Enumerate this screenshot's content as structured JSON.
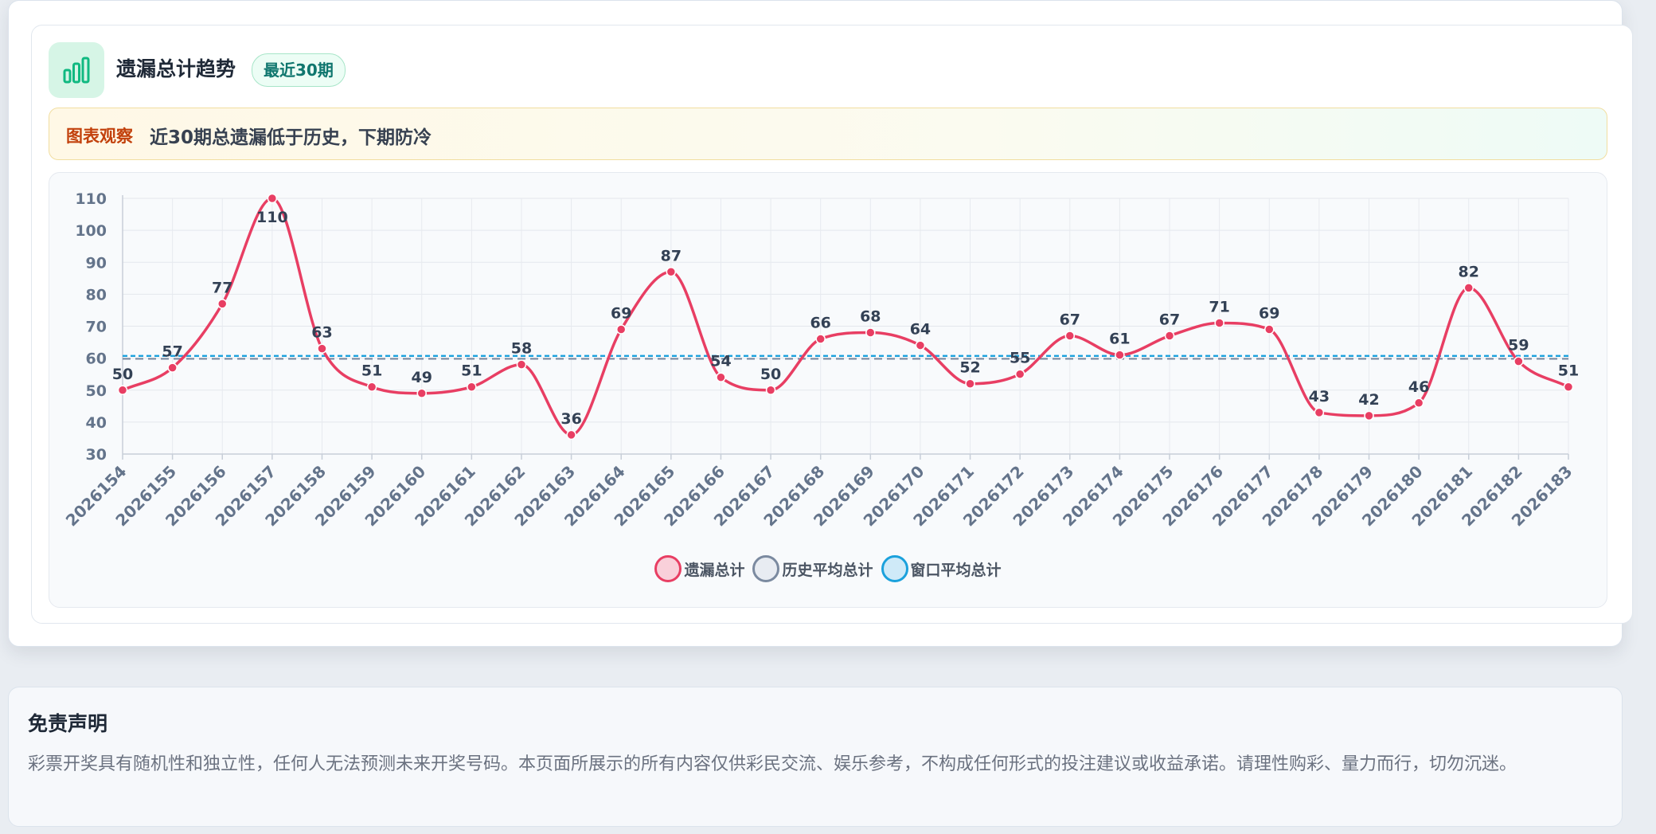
{
  "header": {
    "title": "遗漏总计趋势",
    "badge": "最近30期",
    "icon": "bar-chart-icon"
  },
  "observation": {
    "label": "图表观察",
    "text": "近30期总遗漏低于历史，下期防冷"
  },
  "legend": [
    {
      "label": "遗漏总计",
      "color": "#e83e63",
      "fill": "#f9d0da"
    },
    {
      "label": "历史平均总计",
      "color": "#7b8aa0",
      "fill": "#e8ecf2"
    },
    {
      "label": "窗口平均总计",
      "color": "#1ba1dc",
      "fill": "#cfeaf8"
    }
  ],
  "chart_data": {
    "type": "line",
    "categories": [
      "2026154",
      "2026155",
      "2026156",
      "2026157",
      "2026158",
      "2026159",
      "2026160",
      "2026161",
      "2026162",
      "2026163",
      "2026164",
      "2026165",
      "2026166",
      "2026167",
      "2026168",
      "2026169",
      "2026170",
      "2026171",
      "2026172",
      "2026173",
      "2026174",
      "2026175",
      "2026176",
      "2026177",
      "2026178",
      "2026179",
      "2026180",
      "2026181",
      "2026182",
      "2026183"
    ],
    "series": [
      {
        "name": "遗漏总计",
        "values": [
          50,
          57,
          77,
          110,
          63,
          51,
          49,
          51,
          58,
          36,
          69,
          87,
          54,
          50,
          66,
          68,
          64,
          52,
          55,
          67,
          61,
          67,
          71,
          69,
          43,
          42,
          46,
          82,
          59,
          51
        ],
        "color": "#e83e63"
      },
      {
        "name": "历史平均总计",
        "values": [
          59.8
        ],
        "color": "#7b8aa0"
      },
      {
        "name": "窗口平均总计",
        "values": [
          60.7
        ],
        "color": "#1ba1dc"
      }
    ],
    "ylim": [
      30,
      110
    ],
    "yticks": [
      110,
      100,
      90,
      80,
      70,
      60,
      50,
      40,
      30
    ],
    "grid": true,
    "legend_position": "bottom-center"
  },
  "disclaimer": {
    "title": "免责声明",
    "text": "彩票开奖具有随机性和独立性，任何人无法预测未来开奖号码。本页面所展示的所有内容仅供彩民交流、娱乐参考，不构成任何形式的投注建议或收益承诺。请理性购彩、量力而行，切勿沉迷。"
  }
}
